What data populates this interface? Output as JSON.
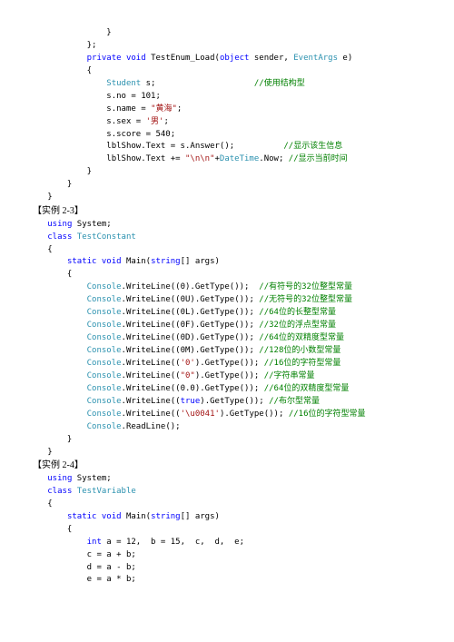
{
  "block1": {
    "indent_base": "               ",
    "sig": {
      "priv": "private",
      "void": "void",
      "name": "TestEnum_Load(",
      "obj": "object",
      "sender": " sender, ",
      "evargs": "EventArgs",
      "e": " e)"
    },
    "l_student": "Student",
    "l_s": " s;",
    "c_struct": "//使用结构型",
    "l_no": "s.no = 101;",
    "l_name_a": "s.name = ",
    "l_name_b": "\"黄海\"",
    "l_name_c": ";",
    "l_sex_a": "s.sex = ",
    "l_sex_b": "'男'",
    "l_sex_c": ";",
    "l_score": "s.score = 540;",
    "l_show": "lblShow.Text = s.Answer();",
    "c_show": "//显示该生信息",
    "l_dt_a": "lblShow.Text += ",
    "l_dt_b": "\"\\n\\n\"",
    "l_dt_c": "+",
    "l_dt_d": "DateTime",
    "l_dt_e": ".Now;",
    "c_dt": "//显示当前时间"
  },
  "ex23": {
    "title": "【实例 2-3】",
    "using_a": "using",
    "using_b": " System;",
    "class_a": "class",
    "class_b": "TestConstant",
    "main_a": "static",
    "main_b": "void",
    "main_c": " Main(",
    "main_d": "string",
    "main_e": "[] args)",
    "rows": [
      {
        "lit": "(0)",
        "com": "//有符号的32位整型常量"
      },
      {
        "lit": "(0U)",
        "com": "//无符号的32位整型常量"
      },
      {
        "lit": "(0L)",
        "com": "//64位的长整型常量"
      },
      {
        "lit": "(0F)",
        "com": "//32位的浮点型常量"
      },
      {
        "lit": "(0D)",
        "com": "//64位的双精度型常量"
      },
      {
        "lit": "(0M)",
        "com": "//128位的小数型常量"
      },
      {
        "is_str": true,
        "lit": "'0'",
        "com": "//16位的字符型常量"
      },
      {
        "is_str": true,
        "lit": "\"0\"",
        "com": "//字符串常量"
      },
      {
        "lit": "(0.0)",
        "com": "//64位的双精度型常量"
      },
      {
        "is_kw": true,
        "lit": "true",
        "com": "//布尔型常量"
      },
      {
        "is_str": true,
        "lit": "'\\u0041'",
        "com": "//16位的字符型常量"
      }
    ],
    "console": "Console",
    "write": ".WriteLine(",
    "get": ".GetType());",
    "read": ".ReadLine();"
  },
  "ex24": {
    "title": "【实例 2-4】",
    "using_a": "using",
    "using_b": " System;",
    "class_a": "class",
    "class_b": "TestVariable",
    "main_a": "static",
    "main_b": "void",
    "main_c": " Main(",
    "main_d": "string",
    "main_e": "[] args)",
    "l_int_a": "int",
    "l_int_b": " a = 12,  b = 15,  c,  d,  e;",
    "l_c": "c = a + b;",
    "l_d": "d = a - b;",
    "l_e": "e = a * b;"
  }
}
